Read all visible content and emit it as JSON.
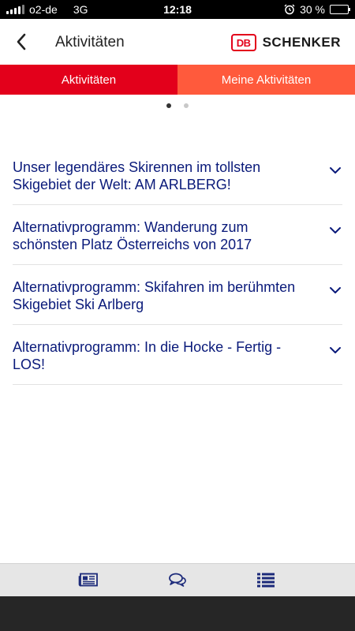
{
  "status_bar": {
    "carrier": "o2-de",
    "network": "3G",
    "time": "12:18",
    "battery": "30 %",
    "battery_level": 0.3
  },
  "header": {
    "back_icon": "chevron-left-icon",
    "title": "Aktivitäten",
    "logo_mark": "DB",
    "logo_text": "SCHENKER"
  },
  "tabs": [
    {
      "label": "Aktivitäten",
      "active": true
    },
    {
      "label": "Meine Aktivitäten",
      "active": false
    }
  ],
  "pager": {
    "count": 2,
    "active_index": 0
  },
  "activities": [
    {
      "title": "Unser legendäres Skirennen im tollsten Skigebiet der Welt: AM ARLBERG!"
    },
    {
      "title": "Alternativprogramm: Wanderung zum schönsten Platz Österreichs von 2017"
    },
    {
      "title": "Alternativprogramm: Skifahren im berühmten Skigebiet Ski Arlberg"
    },
    {
      "title": "Alternativprogramm: In die Hocke - Fertig - LOS!"
    }
  ],
  "toolbar": {
    "items": [
      {
        "icon": "newspaper-icon"
      },
      {
        "icon": "chat-bubbles-icon"
      },
      {
        "icon": "list-icon"
      }
    ]
  },
  "colors": {
    "brand_red": "#e3001b",
    "tab_inactive": "#ff5a3c",
    "link_navy": "#0a1a7a",
    "toolbar_bg": "#e6e6e6",
    "icon_navy": "#1c2a7a"
  }
}
